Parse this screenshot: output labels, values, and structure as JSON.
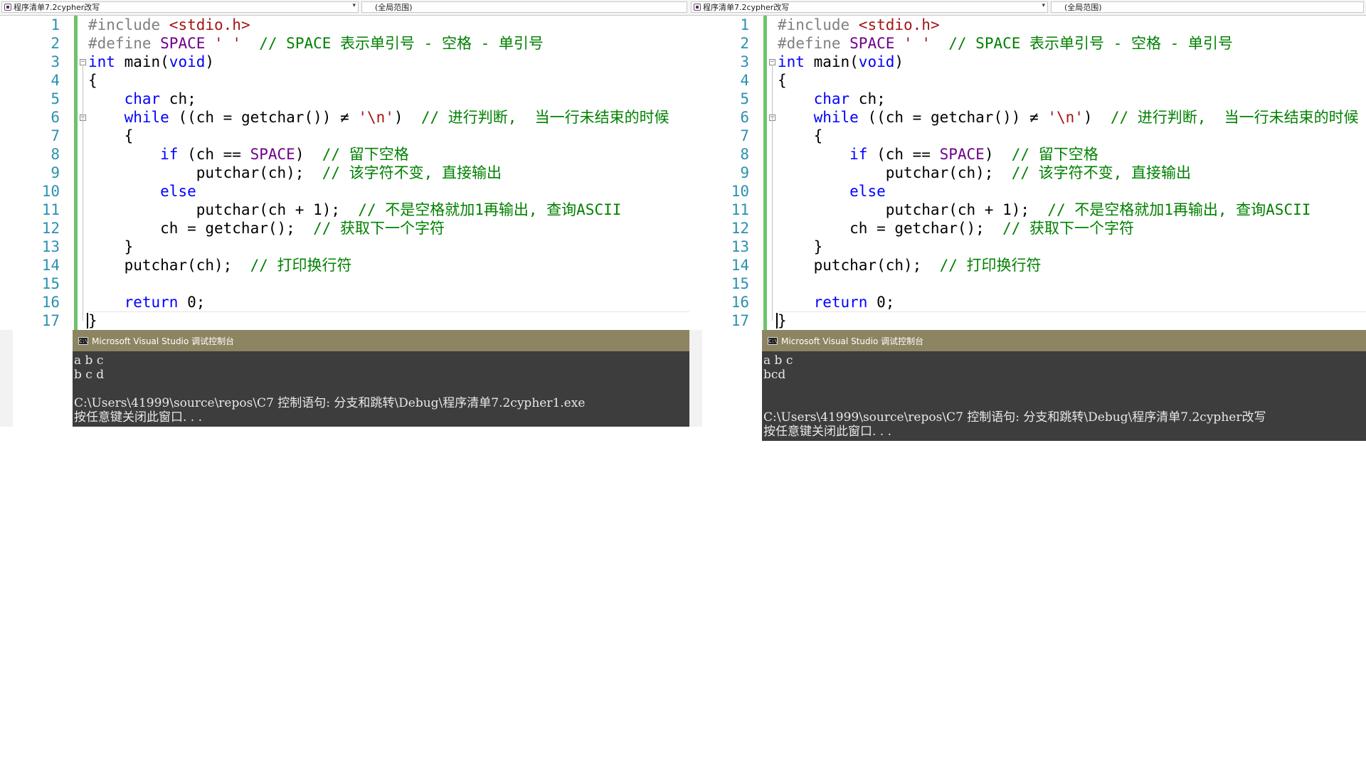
{
  "colors": {
    "keyword": "#0000ff",
    "preprocessor": "#808080",
    "string": "#a31515",
    "macro": "#6f008a",
    "comment": "#008000",
    "line_number": "#2b91af",
    "change_bar": "#6cc36c",
    "console_title_bg": "#8d8462",
    "console_bg": "#3d3d3d"
  },
  "panes": [
    {
      "file_combo": "程序清单7.2cypher改写",
      "scope_combo": "(全局范围)",
      "lines": [
        {
          "num": "1",
          "segs": [
            {
              "t": "#include ",
              "c": "pp"
            },
            {
              "t": "<stdio.h>",
              "c": "str"
            }
          ]
        },
        {
          "num": "2",
          "segs": [
            {
              "t": "#define ",
              "c": "pp"
            },
            {
              "t": "SPACE",
              "c": "mac"
            },
            {
              "t": " ",
              "c": "op"
            },
            {
              "t": "' '",
              "c": "str"
            },
            {
              "t": "  // SPACE 表示单引号 - 空格 - 单引号",
              "c": "cmt"
            }
          ]
        },
        {
          "num": "3",
          "segs": [
            {
              "t": "int",
              "c": "kw"
            },
            {
              "t": " main(",
              "c": "op"
            },
            {
              "t": "void",
              "c": "kw"
            },
            {
              "t": ")",
              "c": "op"
            }
          ]
        },
        {
          "num": "4",
          "segs": [
            {
              "t": "{",
              "c": "op"
            }
          ]
        },
        {
          "num": "5",
          "segs": [
            {
              "t": "    ",
              "c": "op"
            },
            {
              "t": "char",
              "c": "kw"
            },
            {
              "t": " ch;",
              "c": "op"
            }
          ]
        },
        {
          "num": "6",
          "segs": [
            {
              "t": "    ",
              "c": "op"
            },
            {
              "t": "while",
              "c": "kw"
            },
            {
              "t": " ((ch = getchar()) ≠ ",
              "c": "op"
            },
            {
              "t": "'\\n'",
              "c": "str"
            },
            {
              "t": ")  ",
              "c": "op"
            },
            {
              "t": "// 进行判断,  当一行未结束的时候",
              "c": "cmt"
            }
          ]
        },
        {
          "num": "7",
          "segs": [
            {
              "t": "    {",
              "c": "op"
            }
          ]
        },
        {
          "num": "8",
          "segs": [
            {
              "t": "        ",
              "c": "op"
            },
            {
              "t": "if",
              "c": "kw"
            },
            {
              "t": " (ch == ",
              "c": "op"
            },
            {
              "t": "SPACE",
              "c": "mac"
            },
            {
              "t": ")  ",
              "c": "op"
            },
            {
              "t": "// 留下空格",
              "c": "cmt"
            }
          ]
        },
        {
          "num": "9",
          "segs": [
            {
              "t": "            putchar(ch);  ",
              "c": "op"
            },
            {
              "t": "// 该字符不变, 直接输出",
              "c": "cmt"
            }
          ]
        },
        {
          "num": "10",
          "segs": [
            {
              "t": "        ",
              "c": "op"
            },
            {
              "t": "else",
              "c": "kw"
            }
          ]
        },
        {
          "num": "11",
          "segs": [
            {
              "t": "            putchar(ch + 1);  ",
              "c": "op"
            },
            {
              "t": "// 不是空格就加1再输出, 查询ASCII",
              "c": "cmt"
            }
          ]
        },
        {
          "num": "12",
          "segs": [
            {
              "t": "        ch = getchar();  ",
              "c": "op"
            },
            {
              "t": "// 获取下一个字符",
              "c": "cmt"
            }
          ]
        },
        {
          "num": "13",
          "segs": [
            {
              "t": "    }",
              "c": "op"
            }
          ]
        },
        {
          "num": "14",
          "segs": [
            {
              "t": "    putchar(ch);  ",
              "c": "op"
            },
            {
              "t": "// 打印换行符",
              "c": "cmt"
            }
          ]
        },
        {
          "num": "15",
          "segs": []
        },
        {
          "num": "16",
          "segs": [
            {
              "t": "    ",
              "c": "op"
            },
            {
              "t": "return",
              "c": "kw"
            },
            {
              "t": " 0;",
              "c": "op"
            }
          ]
        },
        {
          "num": "17",
          "segs": [
            {
              "t": "}",
              "c": "op"
            }
          ]
        }
      ],
      "console": {
        "icon": "C:\\",
        "title": "Microsoft Visual Studio 调试控制台",
        "lines": [
          "a b c",
          "b c d",
          "",
          "C:\\Users\\41999\\source\\repos\\C7 控制语句: 分支和跳转\\Debug\\程序清单7.2cypher1.exe",
          "按任意键关闭此窗口. . ."
        ]
      }
    },
    {
      "file_combo": "程序清单7.2cypher改写",
      "scope_combo": "(全局范围)",
      "lines": [
        {
          "num": "1",
          "segs": [
            {
              "t": "#include ",
              "c": "pp"
            },
            {
              "t": "<stdio.h>",
              "c": "str"
            }
          ]
        },
        {
          "num": "2",
          "segs": [
            {
              "t": "#define ",
              "c": "pp"
            },
            {
              "t": "SPACE",
              "c": "mac"
            },
            {
              "t": " ",
              "c": "op"
            },
            {
              "t": "' '",
              "c": "str"
            },
            {
              "t": "  // SPACE 表示单引号 - 空格 - 单引号",
              "c": "cmt"
            }
          ]
        },
        {
          "num": "3",
          "segs": [
            {
              "t": "int",
              "c": "kw"
            },
            {
              "t": " main(",
              "c": "op"
            },
            {
              "t": "void",
              "c": "kw"
            },
            {
              "t": ")",
              "c": "op"
            }
          ]
        },
        {
          "num": "4",
          "segs": [
            {
              "t": "{",
              "c": "op"
            }
          ]
        },
        {
          "num": "5",
          "segs": [
            {
              "t": "    ",
              "c": "op"
            },
            {
              "t": "char",
              "c": "kw"
            },
            {
              "t": " ch;",
              "c": "op"
            }
          ]
        },
        {
          "num": "6",
          "segs": [
            {
              "t": "    ",
              "c": "op"
            },
            {
              "t": "while",
              "c": "kw"
            },
            {
              "t": " ((ch = getchar()) ≠ ",
              "c": "op"
            },
            {
              "t": "'\\n'",
              "c": "str"
            },
            {
              "t": ")  ",
              "c": "op"
            },
            {
              "t": "// 进行判断,  当一行未结束的时候",
              "c": "cmt"
            }
          ]
        },
        {
          "num": "7",
          "segs": [
            {
              "t": "    {",
              "c": "op"
            }
          ]
        },
        {
          "num": "8",
          "segs": [
            {
              "t": "        ",
              "c": "op"
            },
            {
              "t": "if",
              "c": "kw"
            },
            {
              "t": " (ch == ",
              "c": "op"
            },
            {
              "t": "SPACE",
              "c": "mac"
            },
            {
              "t": ")  ",
              "c": "op"
            },
            {
              "t": "// 留下空格",
              "c": "cmt"
            }
          ]
        },
        {
          "num": "9",
          "segs": [
            {
              "t": "            putchar(ch);  ",
              "c": "op"
            },
            {
              "t": "// 该字符不变, 直接输出",
              "c": "cmt"
            }
          ]
        },
        {
          "num": "10",
          "segs": [
            {
              "t": "        ",
              "c": "op"
            },
            {
              "t": "else",
              "c": "kw"
            }
          ]
        },
        {
          "num": "11",
          "segs": [
            {
              "t": "            putchar(ch + 1);  ",
              "c": "op"
            },
            {
              "t": "// 不是空格就加1再输出, 查询ASCII",
              "c": "cmt"
            }
          ]
        },
        {
          "num": "12",
          "segs": [
            {
              "t": "        ch = getchar();  ",
              "c": "op"
            },
            {
              "t": "// 获取下一个字符",
              "c": "cmt"
            }
          ]
        },
        {
          "num": "13",
          "segs": [
            {
              "t": "    }",
              "c": "op"
            }
          ]
        },
        {
          "num": "14",
          "segs": [
            {
              "t": "    putchar(ch);  ",
              "c": "op"
            },
            {
              "t": "// 打印换行符",
              "c": "cmt"
            }
          ]
        },
        {
          "num": "15",
          "segs": []
        },
        {
          "num": "16",
          "segs": [
            {
              "t": "    ",
              "c": "op"
            },
            {
              "t": "return",
              "c": "kw"
            },
            {
              "t": " 0;",
              "c": "op"
            }
          ]
        },
        {
          "num": "17",
          "segs": [
            {
              "t": "}",
              "c": "op"
            }
          ]
        }
      ],
      "console": {
        "icon": "C:\\",
        "title": "Microsoft Visual Studio 调试控制台",
        "lines": [
          "a b c",
          "bcd",
          "",
          "",
          "C:\\Users\\41999\\source\\repos\\C7 控制语句: 分支和跳转\\Debug\\程序清单7.2cypher改写",
          "按任意键关闭此窗口. . ."
        ]
      }
    }
  ]
}
